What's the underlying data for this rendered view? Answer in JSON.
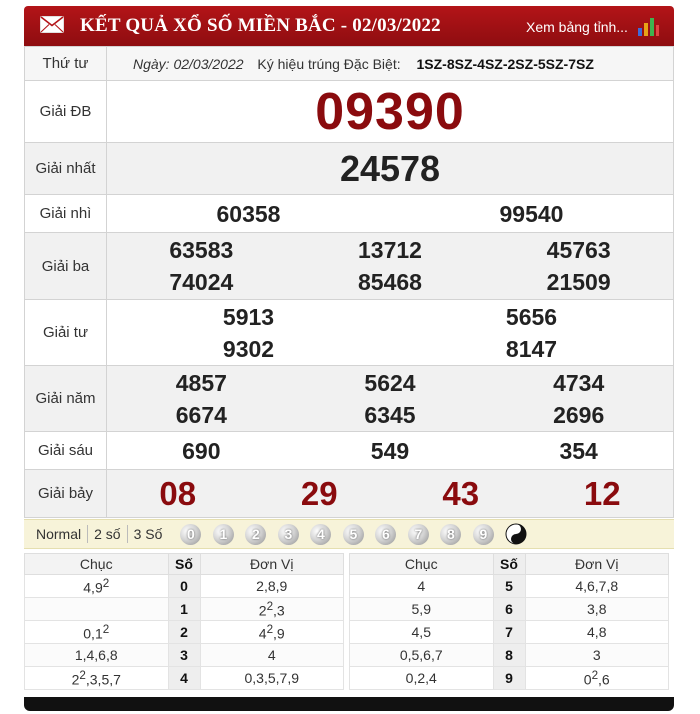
{
  "header": {
    "title": "KẾT QUẢ XỔ SỐ MIỀN BẮC - 02/03/2022",
    "link": "Xem bảng tỉnh..."
  },
  "info": {
    "weekday": "Thứ tư",
    "date_label": "Ngày: 02/03/2022",
    "sign_label": "Ký hiệu trúng Đặc Biệt:",
    "sign_code": "1SZ-8SZ-4SZ-2SZ-5SZ-7SZ"
  },
  "prizes": {
    "db": {
      "label": "Giải ĐB",
      "numbers": [
        "09390"
      ]
    },
    "g1": {
      "label": "Giải nhất",
      "numbers": [
        "24578"
      ]
    },
    "g2": {
      "label": "Giải nhì",
      "numbers": [
        "60358",
        "99540"
      ]
    },
    "g3": {
      "label": "Giải ba",
      "numbers": [
        "63583",
        "13712",
        "45763",
        "74024",
        "85468",
        "21509"
      ]
    },
    "g4": {
      "label": "Giải tư",
      "numbers": [
        "5913",
        "5656",
        "9302",
        "8147"
      ]
    },
    "g5": {
      "label": "Giải năm",
      "numbers": [
        "4857",
        "5624",
        "4734",
        "6674",
        "6345",
        "2696"
      ]
    },
    "g6": {
      "label": "Giải sáu",
      "numbers": [
        "690",
        "549",
        "354"
      ]
    },
    "g7": {
      "label": "Giải bảy",
      "numbers": [
        "08",
        "29",
        "43",
        "12"
      ]
    }
  },
  "tools": {
    "modes": [
      "Normal",
      "2 số",
      "3 Số"
    ],
    "digits": [
      "0",
      "1",
      "2",
      "3",
      "4",
      "5",
      "6",
      "7",
      "8",
      "9"
    ]
  },
  "loto": {
    "headers": {
      "chuc": "Chục",
      "so": "Số",
      "donvi": "Đơn Vị"
    },
    "left": [
      {
        "chuc": "4,9",
        "chuc_sup": "2",
        "so": "0",
        "donvi": "2,8,9"
      },
      {
        "chuc": "",
        "so": "1",
        "donvi": "2",
        "donvi_sup": "2",
        "donvi_rest": ",3"
      },
      {
        "chuc": "0,1",
        "chuc_sup": "2",
        "so": "2",
        "donvi": "4",
        "donvi_sup": "2",
        "donvi_rest": ",9"
      },
      {
        "chuc": "1,4,6,8",
        "so": "3",
        "donvi": "4"
      },
      {
        "chuc": "2",
        "chuc_sup": "2",
        "chuc_rest": ",3,5,7",
        "so": "4",
        "donvi": "0,3,5,7,9"
      }
    ],
    "right": [
      {
        "chuc": "4",
        "so": "5",
        "donvi": "4,6,7,8"
      },
      {
        "chuc": "5,9",
        "so": "6",
        "donvi": "3,8"
      },
      {
        "chuc": "4,5",
        "so": "7",
        "donvi": "4,8"
      },
      {
        "chuc": "0,5,6,7",
        "so": "8",
        "donvi": "3"
      },
      {
        "chuc": "0,2,4",
        "so": "9",
        "donvi": "0",
        "donvi_sup": "2",
        "donvi_rest": ",6"
      }
    ]
  },
  "colors": {
    "header_red": "#a31114",
    "special_red": "#8a0b0e",
    "toolbar_bg": "#f7f3d9"
  }
}
